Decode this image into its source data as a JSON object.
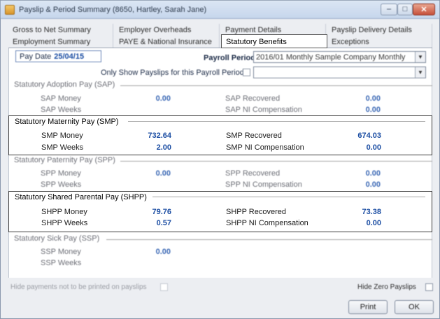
{
  "window": {
    "title": "Payslip & Period Summary (8650, Hartley, Sarah Jane)",
    "controls": {
      "minimize": "–",
      "maximize": "□",
      "close": "✕"
    }
  },
  "tabs": {
    "row1": [
      "Gross to Net Summary",
      "Employer Overheads",
      "Payment Details",
      "Payslip Delivery Details"
    ],
    "row2": [
      "Employment Summary",
      "PAYE & National Insurance",
      "Statutory Benefits",
      "Exceptions"
    ],
    "active": "Statutory Benefits"
  },
  "filters": {
    "pay_date_label": "Pay Date",
    "pay_date_value": "25/04/15",
    "payroll_period_label": "Payroll Period",
    "payroll_period_value": "2016/01 Monthly Sample Company Monthly",
    "only_show_label": "Only Show Payslips for this Payroll Period",
    "only_show_value": ""
  },
  "sections": {
    "sap": {
      "title": "Statutory Adoption Pay (SAP)",
      "money_label": "SAP Money",
      "money_value": "0.00",
      "weeks_label": "SAP Weeks",
      "recovered_label": "SAP Recovered",
      "recovered_value": "0.00",
      "ni_label": "SAP NI Compensation",
      "ni_value": "0.00"
    },
    "smp": {
      "title": "Statutory Maternity Pay (SMP)",
      "money_label": "SMP Money",
      "money_value": "732.64",
      "weeks_label": "SMP Weeks",
      "weeks_value": "2.00",
      "recovered_label": "SMP Recovered",
      "recovered_value": "674.03",
      "ni_label": "SMP NI Compensation",
      "ni_value": "0.00"
    },
    "spp": {
      "title": "Statutory Paternity Pay (SPP)",
      "money_label": "SPP Money",
      "money_value": "0.00",
      "weeks_label": "SPP Weeks",
      "recovered_label": "SPP Recovered",
      "recovered_value": "0.00",
      "ni_label": "SPP NI Compensation",
      "ni_value": "0.00"
    },
    "shpp": {
      "title": "Statutory Shared Parental Pay (SHPP)",
      "money_label": "SHPP Money",
      "money_value": "79.76",
      "weeks_label": "SHPP Weeks",
      "weeks_value": "0.57",
      "recovered_label": "SHPP Recovered",
      "recovered_value": "73.38",
      "ni_label": "SHPP NI Compensation",
      "ni_value": "0.00"
    },
    "ssp": {
      "title": "Statutory Sick Pay (SSP)",
      "money_label": "SSP Money",
      "money_value": "0.00",
      "weeks_label": "SSP Weeks"
    }
  },
  "footer": {
    "hide_not_printed_label": "Hide payments not to be printed on payslips",
    "hide_zero_label": "Hide Zero Payslips",
    "print_label": "Print",
    "ok_label": "OK"
  }
}
